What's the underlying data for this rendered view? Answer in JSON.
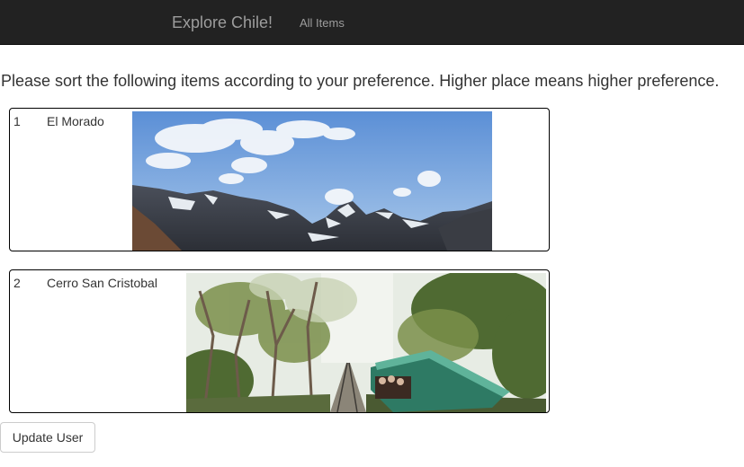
{
  "navbar": {
    "brand": "Explore Chile!",
    "links": [
      {
        "label": "All Items"
      }
    ]
  },
  "instructions": "Please sort the following items according to your preference. Higher place means higher preference.",
  "items": [
    {
      "rank": "1",
      "name": "El Morado",
      "image_subject": "snowy-mountains-photo"
    },
    {
      "rank": "2",
      "name": "Cerro San Cristobal",
      "image_subject": "funicular-forest-photo"
    }
  ],
  "actions": {
    "update_label": "Update User"
  }
}
